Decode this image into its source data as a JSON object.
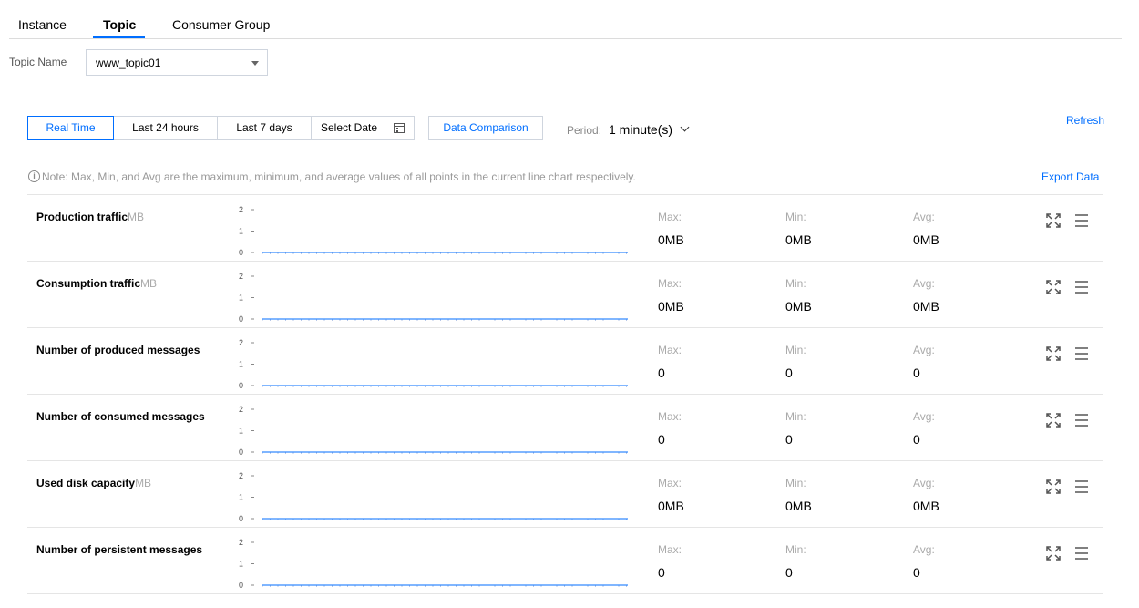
{
  "tabs": [
    {
      "label": "Instance",
      "active": false
    },
    {
      "label": "Topic",
      "active": true
    },
    {
      "label": "Consumer Group",
      "active": false
    }
  ],
  "topic_filter": {
    "label": "Topic Name",
    "value": "www_topic01"
  },
  "time_range": {
    "options": [
      "Real Time",
      "Last 24 hours",
      "Last 7 days"
    ],
    "selected": "Real Time",
    "select_date": "Select Date"
  },
  "data_comparison": "Data Comparison",
  "period": {
    "label": "Period:",
    "value": "1 minute(s)"
  },
  "refresh": "Refresh",
  "export": "Export Data",
  "note": "Note: Max, Min, and Avg are the maximum, minimum, and average values of all points in the current line chart respectively.",
  "stat_labels": {
    "max": "Max:",
    "min": "Min:",
    "avg": "Avg:"
  },
  "series_color": "#006eff",
  "chart_data": [
    {
      "type": "line",
      "title": "Production traffic",
      "unit": "MB",
      "y_ticks": [
        "0",
        "1",
        "2"
      ],
      "ylim": [
        0,
        2
      ],
      "values": [
        0,
        0
      ],
      "stats": {
        "max": "0MB",
        "min": "0MB",
        "avg": "0MB"
      }
    },
    {
      "type": "line",
      "title": "Consumption traffic",
      "unit": "MB",
      "y_ticks": [
        "0",
        "1",
        "2"
      ],
      "ylim": [
        0,
        2
      ],
      "values": [
        0,
        0
      ],
      "stats": {
        "max": "0MB",
        "min": "0MB",
        "avg": "0MB"
      }
    },
    {
      "type": "line",
      "title": "Number of produced messages",
      "unit": "",
      "y_ticks": [
        "0",
        "1",
        "2"
      ],
      "ylim": [
        0,
        2
      ],
      "values": [
        0,
        0
      ],
      "stats": {
        "max": "0",
        "min": "0",
        "avg": "0"
      }
    },
    {
      "type": "line",
      "title": "Number of consumed messages",
      "unit": "",
      "y_ticks": [
        "0",
        "1",
        "2"
      ],
      "ylim": [
        0,
        2
      ],
      "values": [
        0,
        0
      ],
      "stats": {
        "max": "0",
        "min": "0",
        "avg": "0"
      }
    },
    {
      "type": "line",
      "title": "Used disk capacity",
      "unit": "MB",
      "y_ticks": [
        "0",
        "1",
        "2"
      ],
      "ylim": [
        0,
        2
      ],
      "values": [
        0,
        0
      ],
      "stats": {
        "max": "0MB",
        "min": "0MB",
        "avg": "0MB"
      }
    },
    {
      "type": "line",
      "title": "Number of persistent messages",
      "unit": "",
      "y_ticks": [
        "0",
        "1",
        "2"
      ],
      "ylim": [
        0,
        2
      ],
      "values": [
        0,
        0
      ],
      "stats": {
        "max": "0",
        "min": "0",
        "avg": "0"
      }
    }
  ]
}
